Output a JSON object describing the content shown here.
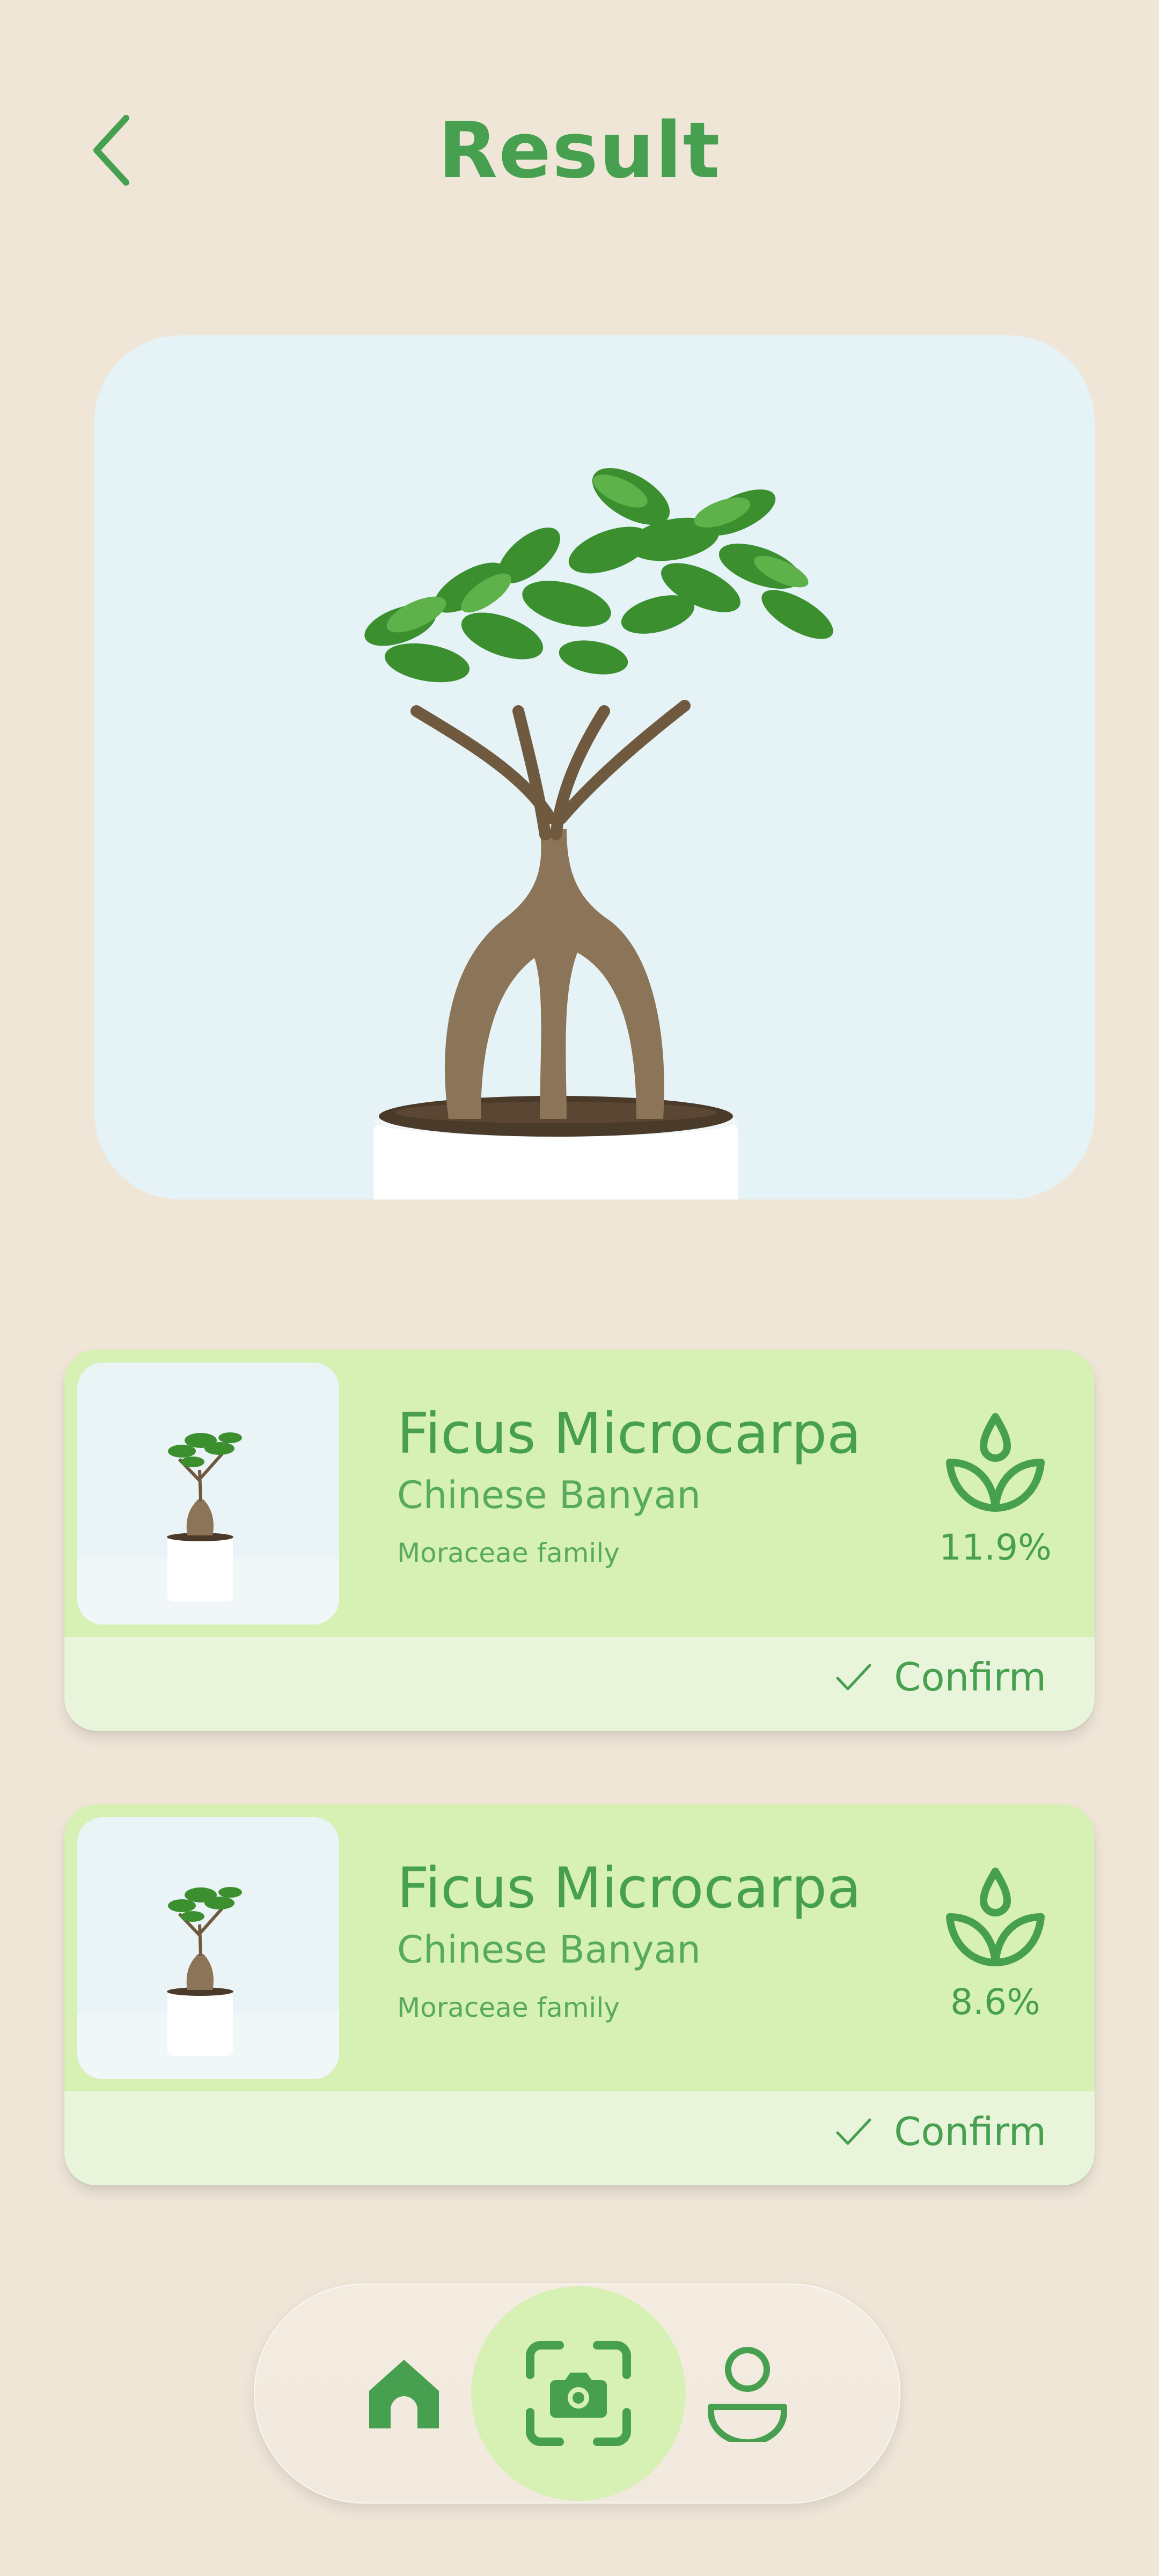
{
  "header": {
    "title": "Result",
    "back_icon": "chevron-left-icon"
  },
  "colors": {
    "background": "#efe6d8",
    "accent_green": "#46a04f",
    "card_top": "#d7f0b4",
    "card_bottom": "#e8f5da",
    "hero_bg": "#e5f3f6"
  },
  "hero": {
    "subject": "bonsai-plant-photo"
  },
  "results": [
    {
      "scientific_name": "Ficus Microcarpa",
      "common_name": "Chinese Banyan",
      "family": "Moraceae family",
      "confidence": "11.9%",
      "confirm_label": "Confirm",
      "icon": "plant-sprout-icon"
    },
    {
      "scientific_name": "Ficus Microcarpa",
      "common_name": "Chinese Banyan",
      "family": "Moraceae family",
      "confidence": "8.6%",
      "confirm_label": "Confirm",
      "icon": "plant-sprout-icon"
    }
  ],
  "nav": {
    "items": [
      {
        "name": "home",
        "icon": "home-icon",
        "active": false
      },
      {
        "name": "scan",
        "icon": "camera-scan-icon",
        "active": true
      },
      {
        "name": "profile",
        "icon": "user-icon",
        "active": false
      }
    ]
  }
}
